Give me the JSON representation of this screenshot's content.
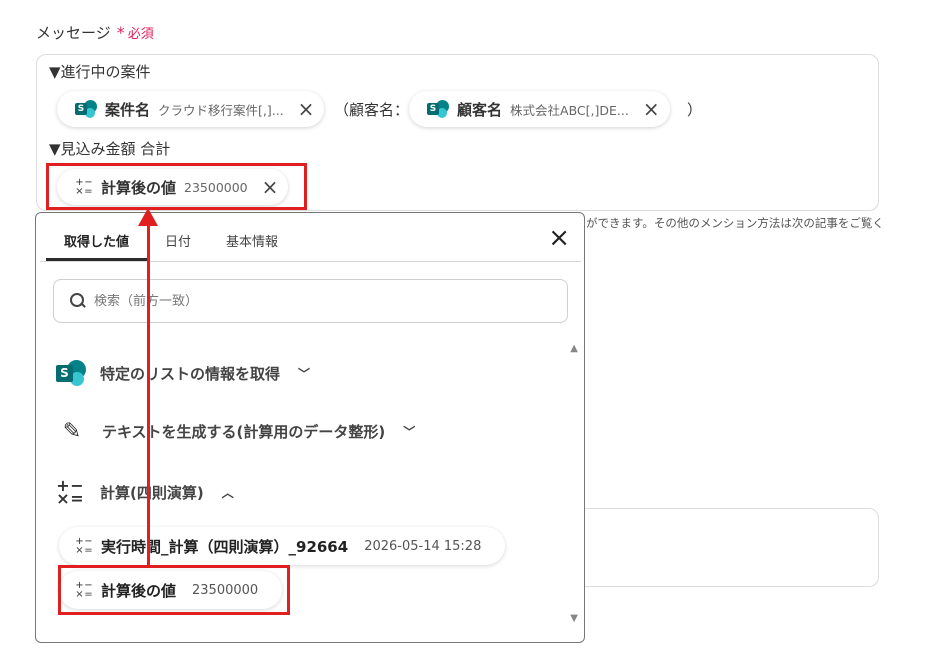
{
  "field": {
    "label": "メッセージ",
    "required_mark": "*",
    "required_text": "必須"
  },
  "message": {
    "line1": "▼進行中の案件",
    "chip1": {
      "label": "案件名",
      "value": "クラウド移行案件[,]...",
      "remove": "×"
    },
    "paren_open": "（顧客名：",
    "chip2": {
      "label": "顧客名",
      "value": "株式会社ABC[,]DE...",
      "remove": "×"
    },
    "paren_close": "）",
    "line2": "▼見込み金額 合計",
    "chip3": {
      "label": "計算後の値",
      "value": "23500000",
      "remove": "×"
    }
  },
  "hint_text": "ができます。その他のメンション方法は次の記事をご覧く",
  "popup": {
    "tabs": [
      {
        "label": "取得した値",
        "active": true
      },
      {
        "label": "日付",
        "active": false
      },
      {
        "label": "基本情報",
        "active": false
      }
    ],
    "close": "×",
    "search": {
      "placeholder": "検索（前方一致）",
      "value": ""
    },
    "sections": [
      {
        "label": "特定のリストの情報を取得",
        "chevron": "﹀",
        "icon": "sharepoint-icon"
      },
      {
        "label": "テキストを生成する(計算用のデータ整形)",
        "chevron": "﹀",
        "icon": "pencil-icon"
      },
      {
        "label": "計算(四則演算)",
        "chevron": "︿",
        "icon": "calculator-icon"
      }
    ],
    "results": [
      {
        "label": "実行時間_計算（四則演算）_92664",
        "value": "2026-05-14 15:28"
      },
      {
        "label": "計算後の値",
        "value": "23500000"
      }
    ],
    "scroll_up": "▲",
    "scroll_down": "▼"
  },
  "icons": {
    "calc_glyphs": [
      "+",
      "−",
      "×",
      "="
    ],
    "sharepoint_letter": "S"
  },
  "colors": {
    "accent_red": "#e02020",
    "required_pink": "#e0245e",
    "sharepoint_teal": "#038387"
  }
}
